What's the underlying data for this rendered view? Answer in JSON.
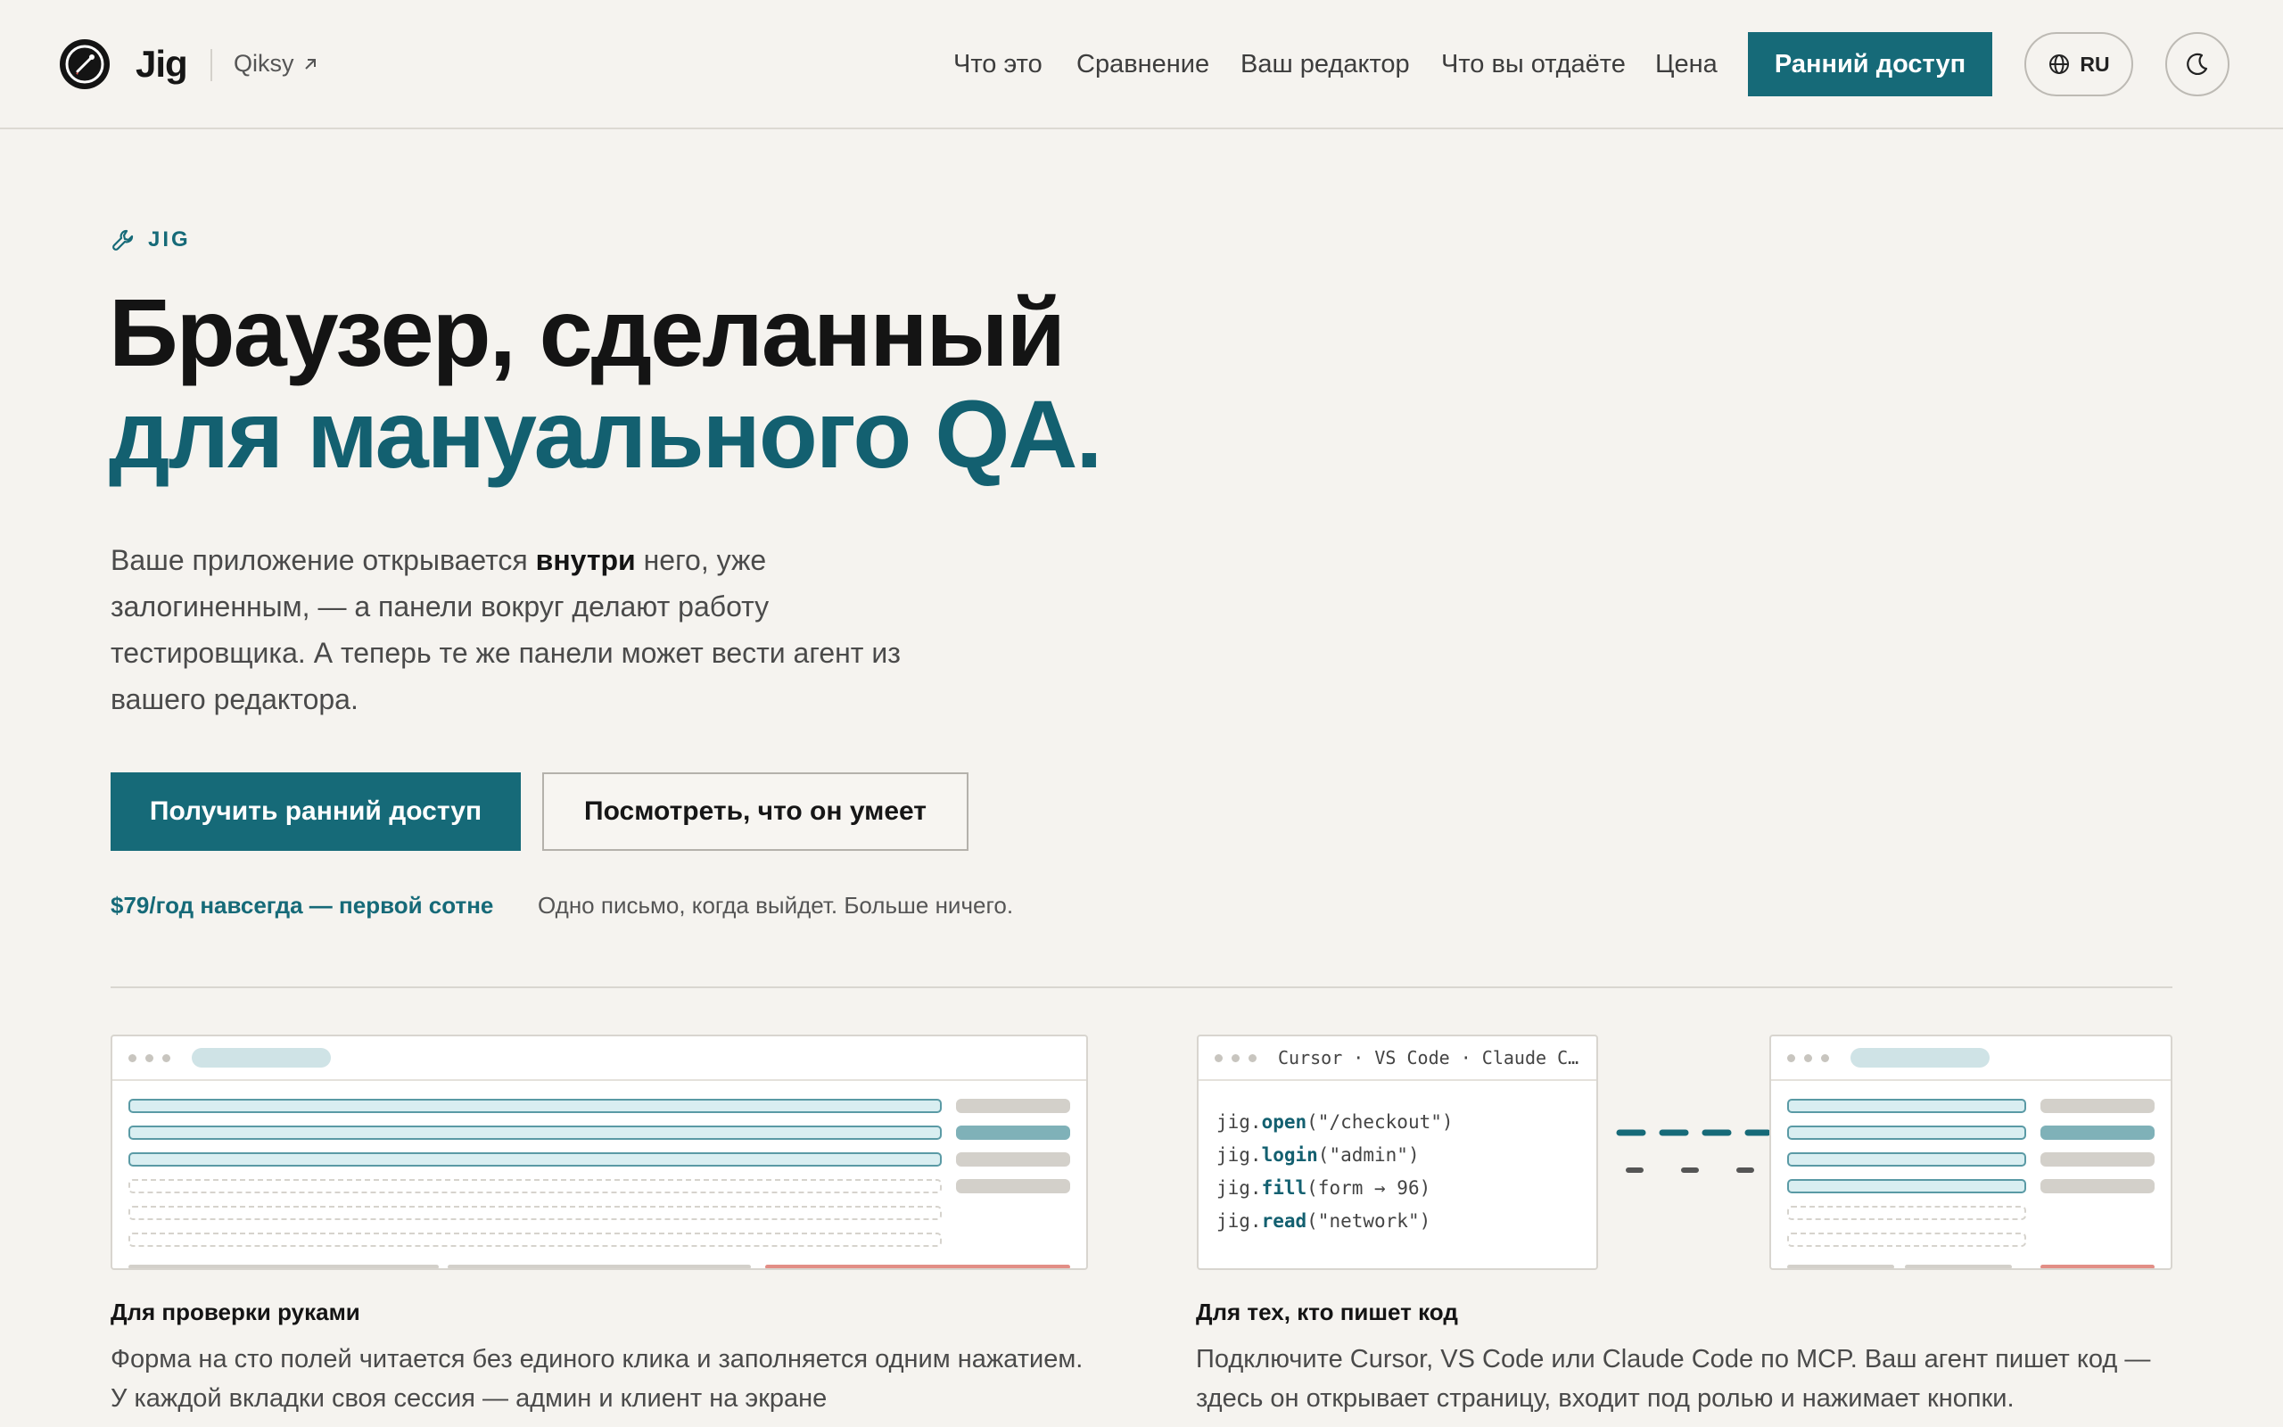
{
  "header": {
    "brand": "Jig",
    "sub_link": "Qiksy",
    "nav": [
      "Что это",
      "Сравнение",
      "Ваш редактор",
      "Что вы отдаёте",
      "Цена"
    ],
    "cta": "Ранний доступ",
    "lang": "RU"
  },
  "hero": {
    "eyebrow": "JIG",
    "title_line1": "Браузер, сделанный",
    "title_line2": "для мануального QA.",
    "lead_before": "Ваше приложение открывается ",
    "lead_bold": "внутри",
    "lead_after": " него, уже залогиненным, — а панели вокруг делают работу тестировщика. А теперь те же панели может вести агент из вашего редактора.",
    "cta_primary": "Получить ранний доступ",
    "cta_secondary": "Посмотреть, что он умеет",
    "price_note": "$79/год навсегда — первой сотне",
    "price_sub": "Одно письмо, когда выйдет. Больше ничего."
  },
  "features": [
    {
      "title": "Для проверки руками",
      "text": "Форма на сто полей читается без единого клика и заполняется одним нажатием. У каждой вкладки своя сессия — админ и клиент на экране"
    },
    {
      "title": "Для тех, кто пишет код",
      "text": "Подключите Cursor, VS Code или Claude Code по MCP. Ваш агент пишет код — здесь он открывает страницу, входит под ролью и нажимает кнопки."
    }
  ],
  "code_window": {
    "title": "Cursor · VS Code · Claude C…",
    "lines": [
      {
        "prefix": "jig.",
        "fn": "open",
        "args": "(\"/checkout\")"
      },
      {
        "prefix": "jig.",
        "fn": "login",
        "args": "(\"admin\")"
      },
      {
        "prefix": "jig.",
        "fn": "fill",
        "args": "(form → 96)"
      },
      {
        "prefix": "jig.",
        "fn": "read",
        "args": "(\"network\")"
      }
    ]
  },
  "colors": {
    "accent": "#166a78",
    "background": "#f5f3ef",
    "text": "#141414"
  }
}
